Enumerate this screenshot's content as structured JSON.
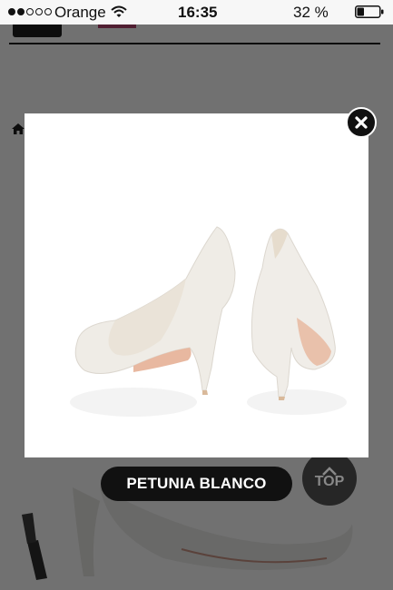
{
  "status_bar": {
    "carrier": "Orange",
    "time": "16:35",
    "battery_percent": "32 %",
    "battery_level": 0.32,
    "signal_bars_filled": 2,
    "signal_bars_total": 5
  },
  "modal": {
    "product_caption": "PETUNIA BLANCO",
    "image_icon": "white-bridal-pumps-image",
    "close_icon": "close-icon"
  },
  "page": {
    "scroll_top_label": "TOP",
    "home_icon": "home-icon"
  },
  "colors": {
    "overlay": "#0a0a0a",
    "caption_bg": "#111111",
    "accent": "#b03a6a"
  }
}
